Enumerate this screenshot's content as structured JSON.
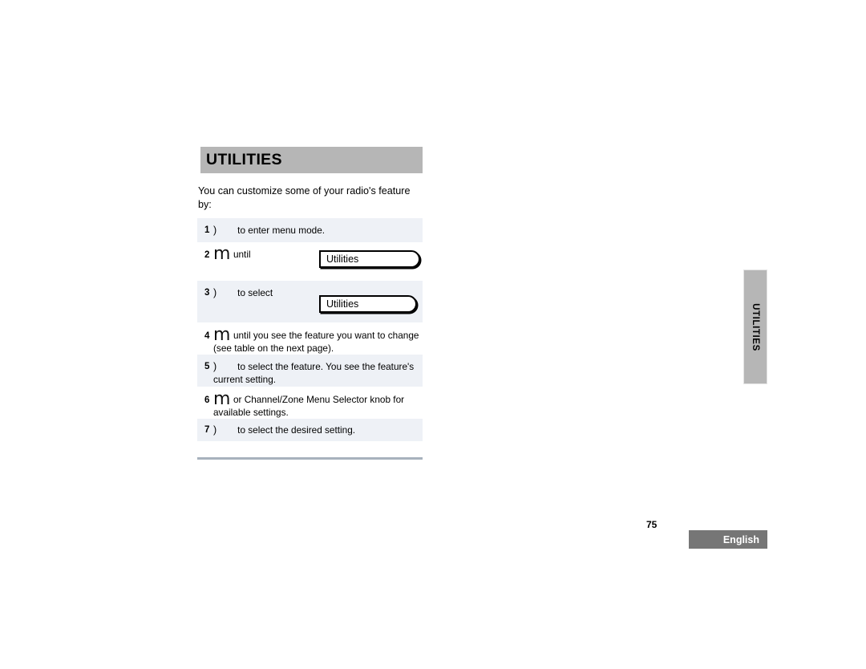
{
  "section": {
    "title": "UTILITIES"
  },
  "intro": {
    "text": "You can customize some of your radio's feature by:"
  },
  "steps": {
    "items": [
      {
        "number": "1",
        "icon": "paren-glyph",
        "text": "to enter menu mode.",
        "shaded": true
      },
      {
        "number": "2",
        "icon": "m-glyph",
        "text": "until",
        "shaded": false
      },
      {
        "number": "3",
        "icon": "paren-glyph",
        "text": "to select",
        "shaded": true
      },
      {
        "number": "4",
        "icon": "m-glyph",
        "text": "until you see the feature you want to change (see table on the next page).",
        "shaded": false
      },
      {
        "number": "5",
        "icon": "paren-glyph",
        "text": "to select the feature. You see the feature's current setting.",
        "shaded": true
      },
      {
        "number": "6",
        "icon": "m-glyph",
        "text": "or Channel/Zone Menu Selector knob for available settings.",
        "shaded": false
      },
      {
        "number": "7",
        "icon": "paren-glyph",
        "text": "to select the desired setting.",
        "shaded": true
      }
    ],
    "glyphs": {
      "paren": ")",
      "m": "m"
    }
  },
  "displays": [
    {
      "value": "Utilities"
    },
    {
      "value": "Utilities"
    }
  ],
  "side_tab": {
    "label": "UTILITIES"
  },
  "footer": {
    "page_number": "75",
    "language": "English"
  },
  "colors": {
    "header_bar": "#b6b6b6",
    "row_shade": "#eef1f6",
    "side_tab": "#b6b6b6",
    "language_badge": "#767676",
    "bottom_rule": "#a8b2bd"
  }
}
